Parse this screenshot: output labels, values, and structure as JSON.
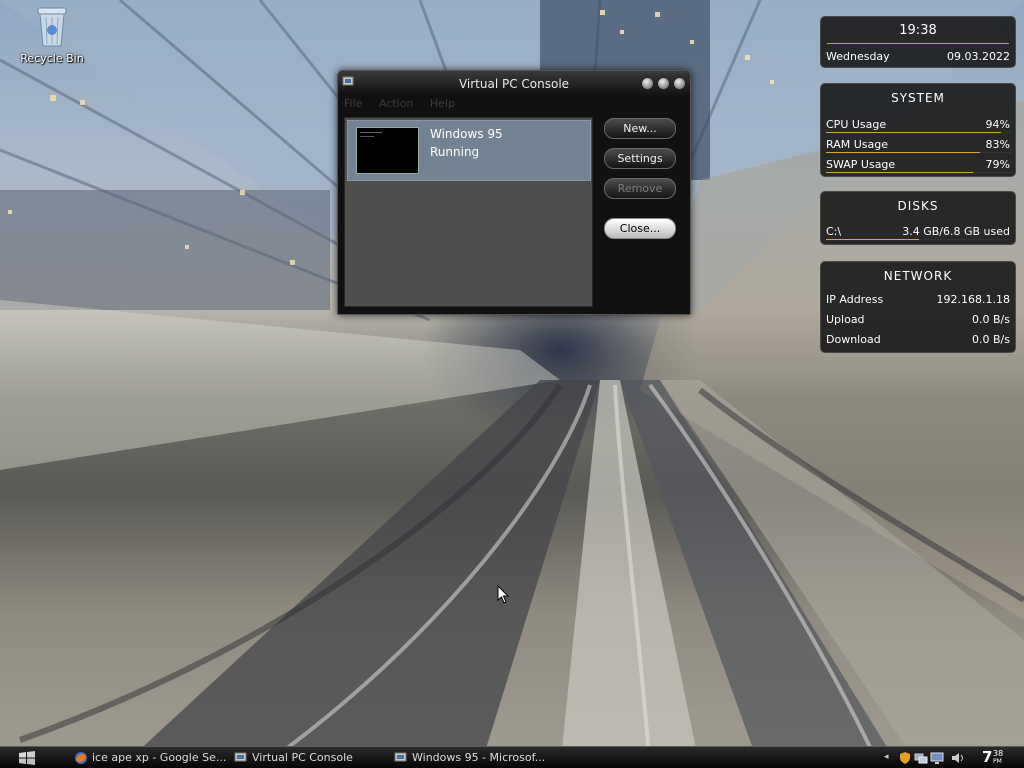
{
  "desktop": {
    "recycle_bin_label": "Recycle Bin"
  },
  "vpc_window": {
    "title": "Virtual PC Console",
    "menu": [
      "File",
      "Action",
      "Help"
    ],
    "vm_list": [
      {
        "name": "Windows 95",
        "status": "Running"
      }
    ],
    "buttons": {
      "new": "New...",
      "settings": "Settings",
      "remove": "Remove",
      "close": "Close..."
    }
  },
  "gadgets": {
    "clock": {
      "time": "19:38",
      "day": "Wednesday",
      "date": "09.03.2022"
    },
    "system": {
      "header": "SYSTEM",
      "rows": [
        {
          "label": "CPU Usage",
          "value": "94%",
          "level": 0.94
        },
        {
          "label": "RAM Usage",
          "value": "83%",
          "level": 0.83
        },
        {
          "label": "SWAP Usage",
          "value": "79%",
          "level": 0.79
        }
      ]
    },
    "disks": {
      "header": "DISKS",
      "rows": [
        {
          "label": "C:\\",
          "value": "3.4 GB/6.8 GB used",
          "level": 0.5
        }
      ]
    },
    "network": {
      "header": "NETWORK",
      "rows": [
        {
          "label": "IP Address",
          "value": "192.168.1.18"
        },
        {
          "label": "Upload",
          "value": "0.0 B/s"
        },
        {
          "label": "Download",
          "value": "0.0 B/s"
        }
      ]
    }
  },
  "taskbar": {
    "items": [
      {
        "label": "ice ape xp - Google Se...",
        "icon": "firefox-icon"
      },
      {
        "label": "Virtual PC Console",
        "icon": "virtual-pc-icon"
      },
      {
        "label": "Windows 95 - Microsof...",
        "icon": "virtual-pc-icon"
      }
    ],
    "clock": {
      "hour": "7",
      "minutes": "38",
      "ampm": "PM"
    }
  },
  "colors": {
    "gadget_accent": "#d8a830",
    "selection": "#748394"
  }
}
